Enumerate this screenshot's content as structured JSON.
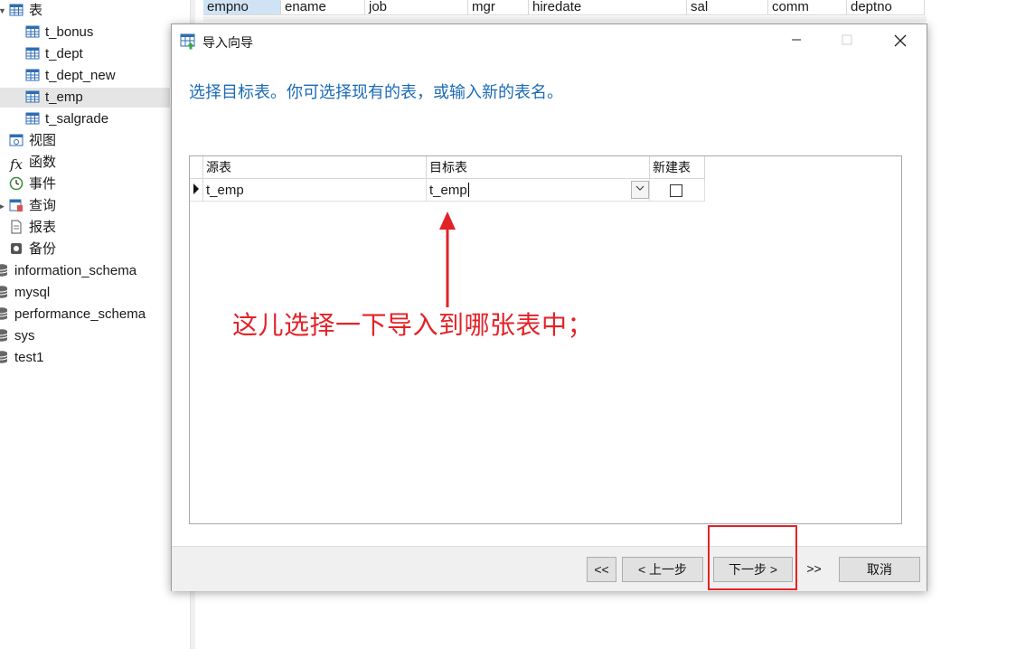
{
  "tree": {
    "tables_folder": "表",
    "tables": [
      "t_bonus",
      "t_dept",
      "t_dept_new",
      "t_emp",
      "t_salgrade"
    ],
    "selected_table": "t_emp",
    "folders": [
      "视图",
      "函数",
      "事件",
      "查询",
      "报表",
      "备份"
    ],
    "databases": [
      "information_schema",
      "mysql",
      "performance_schema",
      "sys",
      "test1"
    ]
  },
  "grid_columns": [
    "empno",
    "ename",
    "job",
    "mgr",
    "hiredate",
    "sal",
    "comm",
    "deptno"
  ],
  "dialog": {
    "title": "导入向导",
    "instruction": "选择目标表。你可选择现有的表，或输入新的表名。",
    "mapping": {
      "headers": [
        "源表",
        "目标表",
        "新建表"
      ],
      "rows": [
        {
          "source": "t_emp",
          "target": "t_emp",
          "new_table": false
        }
      ]
    },
    "buttons": {
      "first": "<<",
      "prev": "< 上一步",
      "next": "下一步 >",
      "last": ">>",
      "cancel": "取消"
    }
  },
  "annotation": {
    "text": "这儿选择一下导入到哪张表中；",
    "color": "#e32228"
  },
  "colors": {
    "accent": "#1c6bb5",
    "annotation": "#e32228",
    "selection": "#e5e5e5"
  }
}
